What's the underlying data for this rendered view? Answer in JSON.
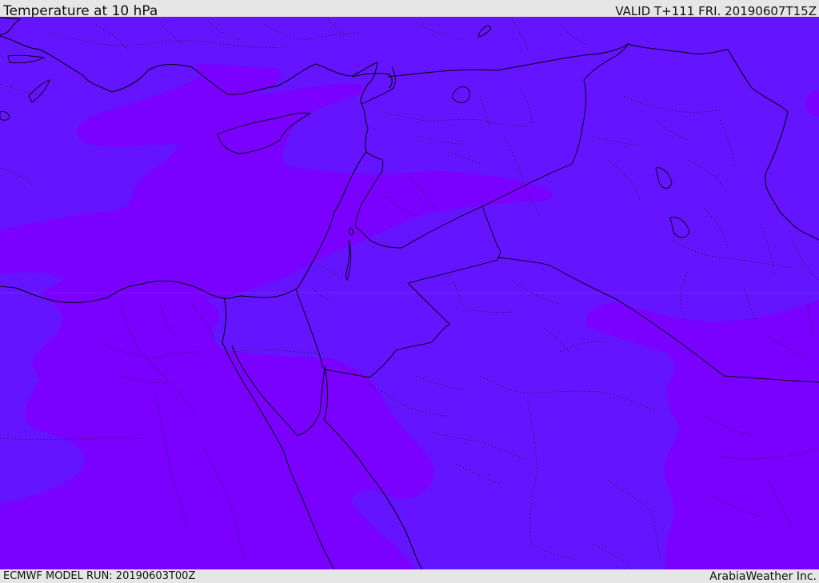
{
  "header": {
    "title": "Temperature at 10 hPa",
    "valid": "VALID T+111 FRI. 20190607T15Z"
  },
  "footer": {
    "model_run": "ECMWF MODEL RUN: 20190603T00Z",
    "credit": "ArabiaWeather Inc."
  },
  "colors": {
    "cool_band": "#6514ff",
    "warm_band": "#7a00ff",
    "frame": "#e6e6e6",
    "lines": "#000000"
  }
}
